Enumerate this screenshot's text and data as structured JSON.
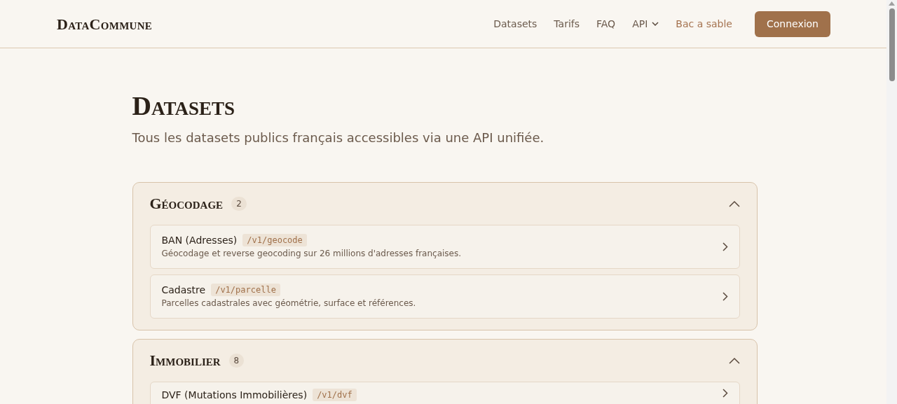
{
  "brand": "DataCommune",
  "nav": [
    {
      "label": "Datasets",
      "kind": "plain",
      "dropdown": false
    },
    {
      "label": "Tarifs",
      "kind": "plain",
      "dropdown": false
    },
    {
      "label": "FAQ",
      "kind": "plain",
      "dropdown": false
    },
    {
      "label": "API",
      "kind": "plain",
      "dropdown": true
    },
    {
      "label": "Bac a sable",
      "kind": "accent",
      "dropdown": false
    }
  ],
  "login_button": "Connexion",
  "page": {
    "title": "Datasets",
    "subtitle": "Tous les datasets publics français accessibles via une API unifiée."
  },
  "sections": [
    {
      "title": "Géocodage",
      "count": "2",
      "expanded": true,
      "datasets": [
        {
          "name": "BAN (Adresses)",
          "endpoint": "/v1/geocode",
          "description": "Géocodage et reverse geocoding sur 26 millions d'adresses françaises."
        },
        {
          "name": "Cadastre",
          "endpoint": "/v1/parcelle",
          "description": "Parcelles cadastrales avec géométrie, surface et références."
        }
      ]
    },
    {
      "title": "Immobilier",
      "count": "8",
      "expanded": true,
      "datasets": [
        {
          "name": "DVF (Mutations Immobilières)",
          "endpoint": "/v1/dvf"
        }
      ]
    }
  ]
}
